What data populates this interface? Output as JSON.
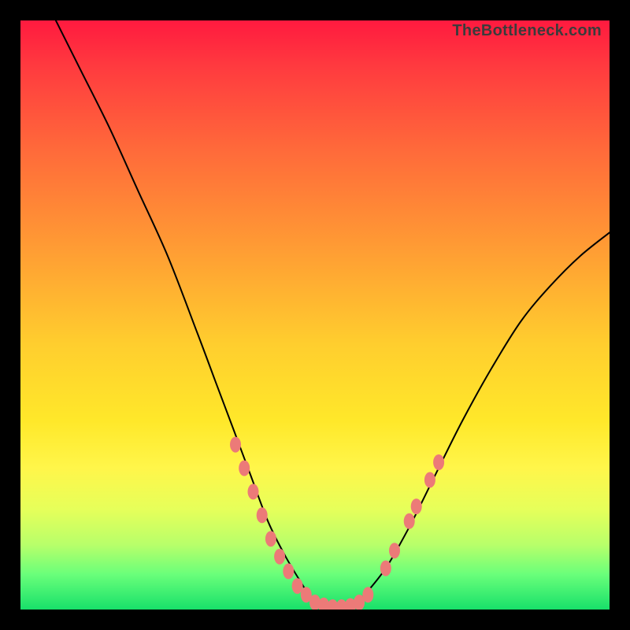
{
  "watermark": "TheBottleneck.com",
  "chart_data": {
    "type": "line",
    "title": "",
    "xlabel": "",
    "ylabel": "",
    "xlim": [
      0,
      100
    ],
    "ylim": [
      0,
      100
    ],
    "series": [
      {
        "name": "bottleneck-curve",
        "x": [
          6,
          10,
          15,
          20,
          25,
          30,
          33,
          36,
          39,
          42,
          45,
          48,
          50,
          52,
          54,
          56,
          58,
          62,
          66,
          70,
          75,
          80,
          85,
          90,
          95,
          100
        ],
        "y": [
          100,
          92,
          82,
          71,
          60,
          47,
          39,
          31,
          23,
          15,
          9,
          4,
          1,
          0,
          0,
          0,
          2,
          7,
          14,
          22,
          32,
          41,
          49,
          55,
          60,
          64
        ]
      }
    ],
    "markers": {
      "name": "highlight-dots",
      "color": "#ec7a78",
      "points": [
        {
          "x": 36.5,
          "y": 28
        },
        {
          "x": 38,
          "y": 24
        },
        {
          "x": 39.5,
          "y": 20
        },
        {
          "x": 41,
          "y": 16
        },
        {
          "x": 42.5,
          "y": 12
        },
        {
          "x": 44,
          "y": 9
        },
        {
          "x": 45.5,
          "y": 6.5
        },
        {
          "x": 47,
          "y": 4
        },
        {
          "x": 48.5,
          "y": 2.5
        },
        {
          "x": 50,
          "y": 1.2
        },
        {
          "x": 51.5,
          "y": 0.7
        },
        {
          "x": 53,
          "y": 0.4
        },
        {
          "x": 54.5,
          "y": 0.4
        },
        {
          "x": 56,
          "y": 0.6
        },
        {
          "x": 57.5,
          "y": 1.2
        },
        {
          "x": 59,
          "y": 2.5
        },
        {
          "x": 62,
          "y": 7
        },
        {
          "x": 63.5,
          "y": 10
        },
        {
          "x": 66,
          "y": 15
        },
        {
          "x": 67.2,
          "y": 17.5
        },
        {
          "x": 69.5,
          "y": 22
        },
        {
          "x": 71,
          "y": 25
        }
      ]
    },
    "background_gradient": {
      "top": "#ff1a3f",
      "mid": "#ffe82a",
      "bottom": "#18e06a"
    }
  }
}
